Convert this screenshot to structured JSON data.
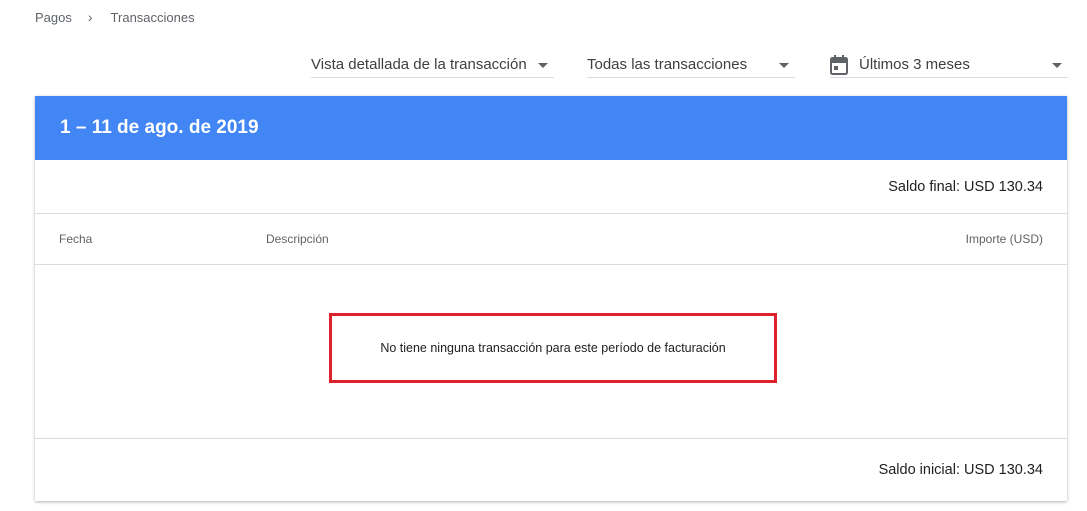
{
  "breadcrumb": {
    "items": [
      "Pagos",
      "Transacciones"
    ],
    "separator": "›"
  },
  "filters": {
    "view": "Vista detallada de la transacción",
    "type": "Todas las transacciones",
    "range": "Últimos 3 meses"
  },
  "card": {
    "header": "1 – 11 de ago. de 2019",
    "ending_balance": "Saldo final: USD 130.34",
    "columns": {
      "date": "Fecha",
      "description": "Descripción",
      "amount": "Importe (USD)"
    },
    "empty_message": "No tiene ninguna transacción para este período de facturación",
    "starting_balance": "Saldo inicial: USD 130.34"
  },
  "colors": {
    "header_bg": "#4285f4",
    "highlight": "#e0202a"
  }
}
